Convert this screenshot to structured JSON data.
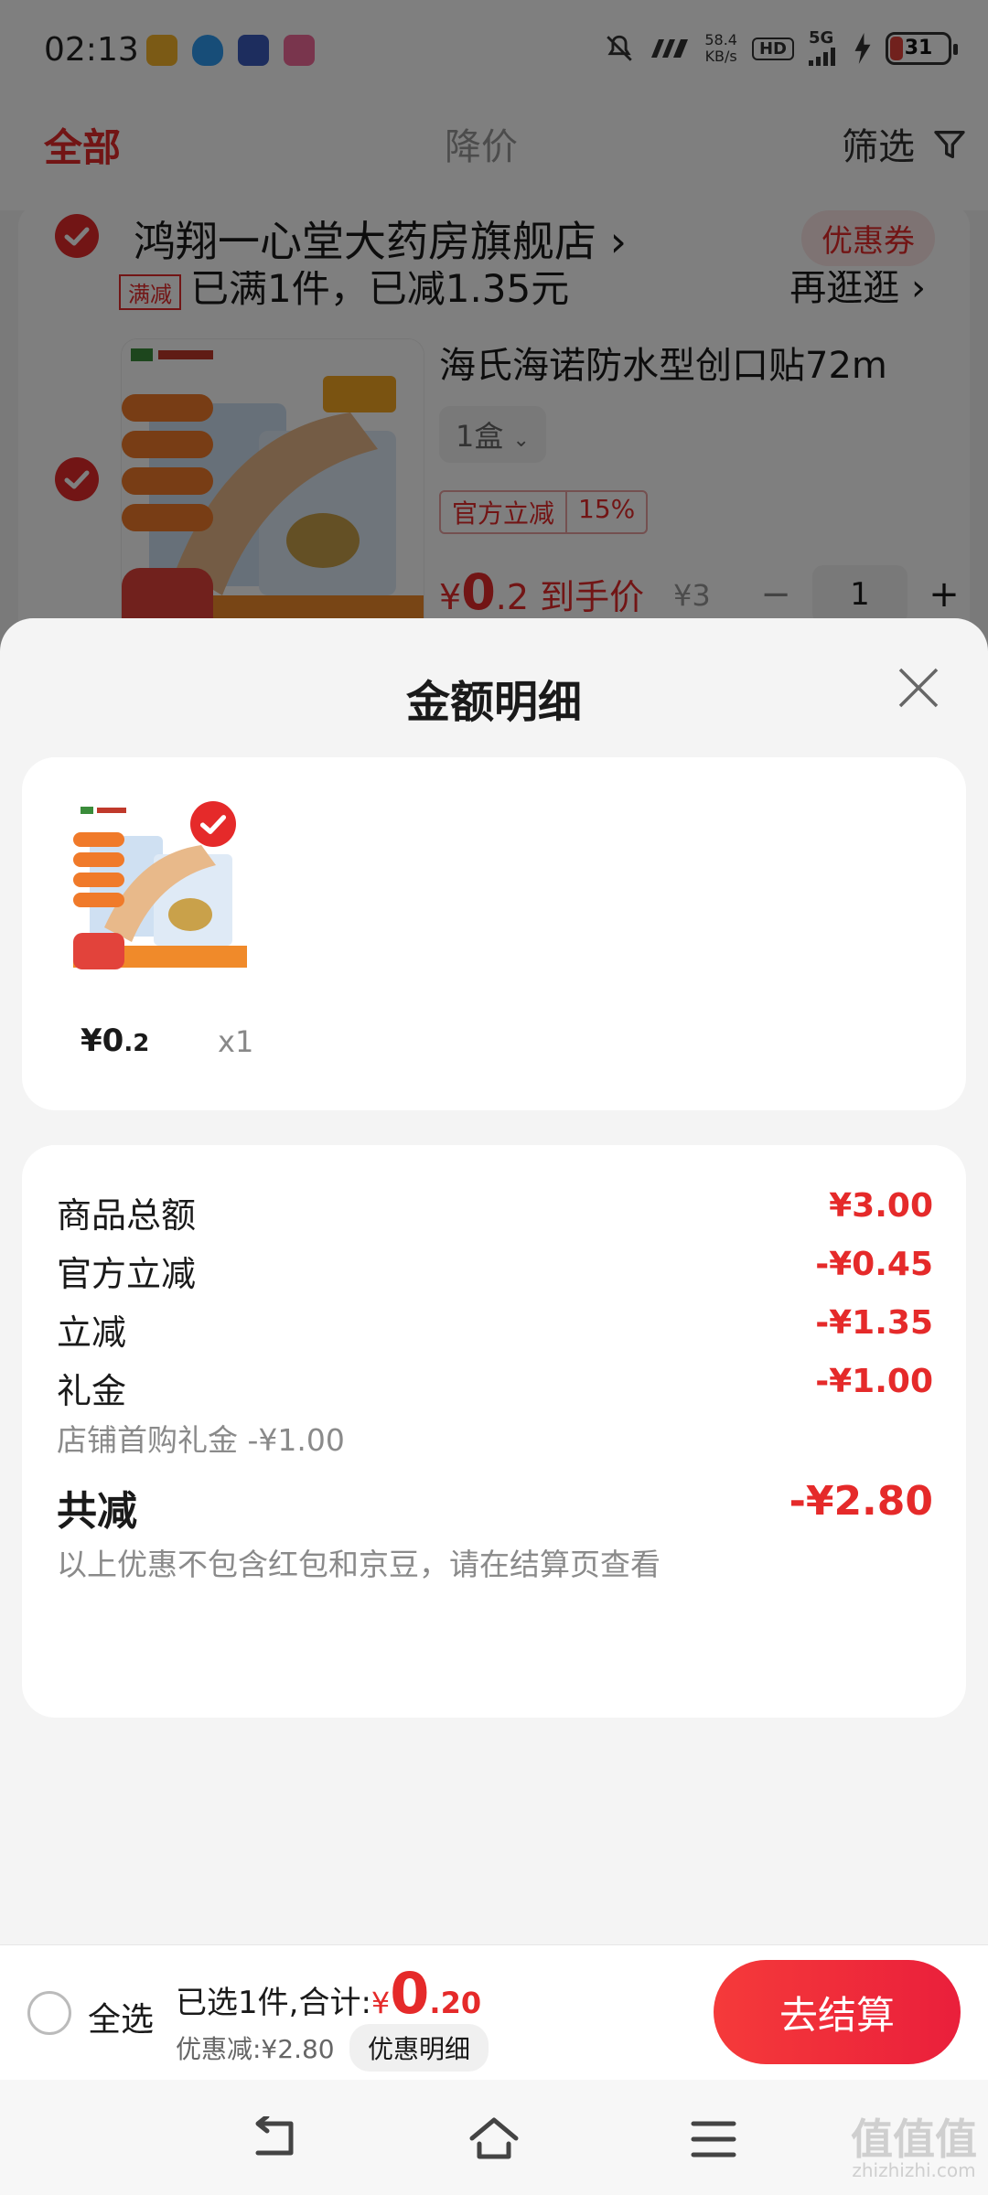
{
  "status_bar": {
    "time": "02:13",
    "speed": "58.4",
    "speed_unit": "KB/s",
    "hd": "HD",
    "network": "5G",
    "battery": "31"
  },
  "tabs": {
    "all": "全部",
    "price_drop": "降价",
    "filter": "筛选"
  },
  "shop": {
    "name": "鸿翔一心堂大药房旗舰店",
    "arrow": "›",
    "coupon": "优惠券",
    "promo_tag": "满减",
    "promo_text": "已满1件，已减1.35元",
    "promo_more": "再逛逛 ›"
  },
  "product": {
    "title": "海氏海诺防水型创口贴72m",
    "spec": "1盒",
    "official_label": "官方立减",
    "official_pct": "15%",
    "price_symbol": "¥",
    "price_int": "0",
    "price_dec": ".2",
    "price_note": "到手价",
    "orig_price": "¥3",
    "qty_minus": "−",
    "qty": "1",
    "qty_plus": "+"
  },
  "sheet": {
    "title": "金额明细",
    "item": {
      "price": "¥0",
      "price_dec": ".2",
      "qty": "x1"
    },
    "rows": [
      {
        "label": "商品总额",
        "value": "¥3.00"
      },
      {
        "label": "官方立减",
        "value": "-¥0.45"
      },
      {
        "label": "立减",
        "value": "-¥1.35"
      },
      {
        "label": "礼金",
        "value": "-¥1.00",
        "sub": "店铺首购礼金 -¥1.00"
      }
    ],
    "total": {
      "label": "共减",
      "value": "-¥2.80",
      "note": "以上优惠不包含红包和京豆，请在结算页查看"
    }
  },
  "bottom": {
    "select_all": "全选",
    "selected_prefix": "已选1件,合计:",
    "currency": "¥",
    "total_int": "0",
    "total_dec": ".20",
    "discount": "优惠减:¥2.80",
    "detail": "优惠明细",
    "checkout": "去结算"
  },
  "watermark": {
    "main": "值值值",
    "sub": "zhizhizhi.com"
  },
  "colors": {
    "accent": "#e52a2a",
    "checkout_start": "#f53a3a",
    "checkout_end": "#ea1f3b"
  }
}
